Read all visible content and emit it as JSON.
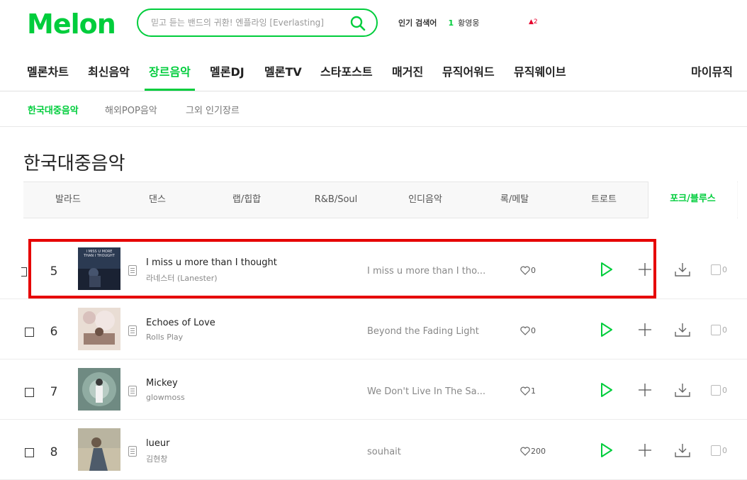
{
  "header": {
    "logo_text": "Melon",
    "search_placeholder": "믿고 듣는 밴드의 귀환! 엔플라잉 [Everlasting]",
    "popular": {
      "label": "인기 검색어",
      "rank": "1",
      "word": "황영웅",
      "change": "▲2"
    }
  },
  "gnb": {
    "items": [
      "멜론차트",
      "최신음악",
      "장르음악",
      "멜론DJ",
      "멜론TV",
      "스타포스트",
      "매거진",
      "뮤직어워드",
      "뮤직웨이브"
    ],
    "active": "장르음악",
    "mymusic": "마이뮤직"
  },
  "lnb": {
    "items": [
      "한국대중음악",
      "해외POP음악",
      "그외 인기장르"
    ],
    "active": "한국대중음악"
  },
  "page_title": "한국대중음악",
  "genre_tabs": {
    "items": [
      "발라드",
      "댄스",
      "랩/힙합",
      "R&B/Soul",
      "인디음악",
      "록/메탈",
      "트로트",
      "포크/블루스"
    ],
    "active": "포크/블루스"
  },
  "songs": [
    {
      "rank": "5",
      "title": "I miss u more than I thought",
      "artist": "라네스터 (Lanester)",
      "album": "I miss u more than I tho...",
      "likes": "0",
      "mv_count": "0",
      "thumb_lines": [
        "I MISS U MORE",
        "THAN I THOUGHT"
      ]
    },
    {
      "rank": "6",
      "title": "Echoes of Love",
      "artist": "Rolls Play",
      "album": "Beyond the Fading Light",
      "likes": "0",
      "mv_count": "0"
    },
    {
      "rank": "7",
      "title": "Mickey",
      "artist": "glowmoss",
      "album": "We Don't Live In The Sa...",
      "likes": "1",
      "mv_count": "0"
    },
    {
      "rank": "8",
      "title": "lueur",
      "artist": "김현창",
      "album": "souhait",
      "likes": "200",
      "mv_count": "0"
    }
  ],
  "colors": {
    "brand": "#00cd3c",
    "highlight": "#e60000"
  }
}
